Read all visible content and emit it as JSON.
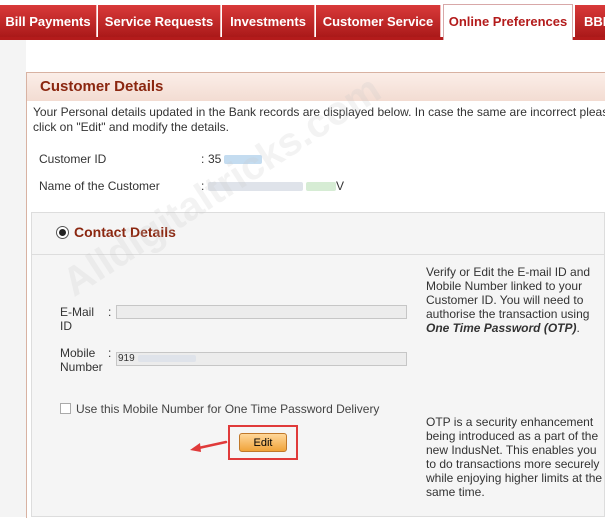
{
  "nav": {
    "tabs": [
      {
        "label": "Bill Payments",
        "active": false
      },
      {
        "label": "Service Requests",
        "active": false
      },
      {
        "label": "Investments",
        "active": false
      },
      {
        "label": "Customer Service",
        "active": false
      },
      {
        "label": "Online Preferences",
        "active": true
      },
      {
        "label": "BBE",
        "active": false
      }
    ]
  },
  "customer_details": {
    "title": "Customer Details",
    "intro": "Your Personal details updated in the Bank records are displayed below. In case the same are incorrect please click on \"Edit\" and modify the details.",
    "customer_id_label": "Customer ID",
    "customer_id_value": "35",
    "name_label": "Name of the Customer",
    "name_value": "V",
    "colon": ":"
  },
  "contact_details": {
    "title": "Contact Details",
    "email_label": "E-Mail ID",
    "email_value": "",
    "mobile_label": "Mobile Number",
    "mobile_value": "919",
    "checkbox_label": "Use this Mobile Number for One Time Password Delivery",
    "edit_label": "Edit",
    "colon": ":",
    "info_text": "Verify or Edit the E-mail ID and Mobile Number linked to your Customer ID. You will need to authorise the transaction using ",
    "info_emphasis": "One Time Password (OTP)",
    "info_end": ".",
    "otp_text": "OTP is a security enhancement being introduced as a part of the new IndusNet. This enables you to do transactions more securely while enjoying higher limits at the same time."
  },
  "watermark": "Alldigitaltricks.com",
  "colors": {
    "brand_red": "#b31b1b",
    "title_brown": "#8b2710",
    "highlight_red": "#e03a3a",
    "button_orange": "#f0a33a"
  }
}
